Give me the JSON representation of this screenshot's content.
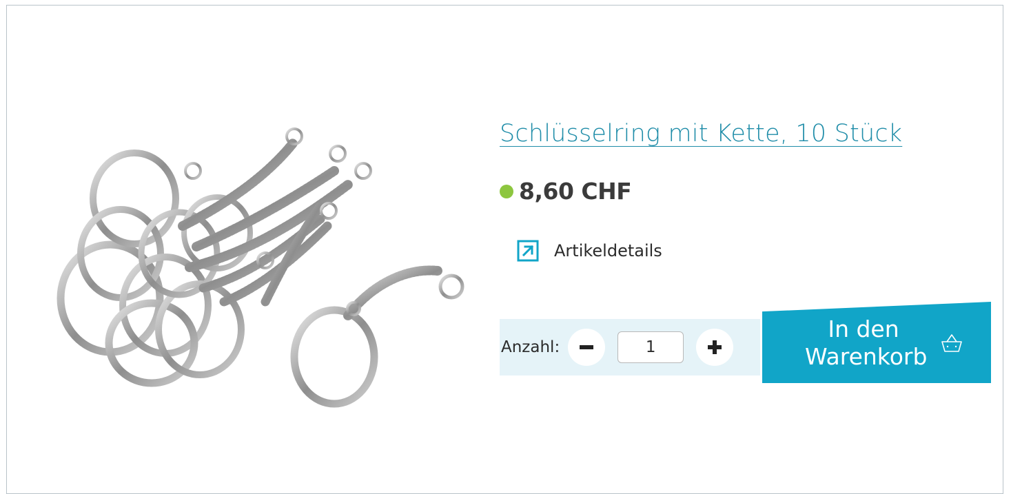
{
  "product": {
    "title": "Schlüsselring mit Kette, 10 Stück",
    "price": "8,60 CHF",
    "availability_color": "#8dc63f",
    "image_icon": "keyring-product-photo"
  },
  "details": {
    "label": "Artikeldetails",
    "icon": "external-link-arrow-icon"
  },
  "quantity": {
    "label": "Anzahl:",
    "value": "1",
    "minus_icon": "minus-icon",
    "plus_icon": "plus-icon"
  },
  "cart": {
    "label_line1": "In den",
    "label_line2": "Warenkorb",
    "icon": "basket-icon"
  },
  "colors": {
    "accent": "#11a5c8",
    "link": "#1e8ca8",
    "qty_background": "#e5f3f8"
  }
}
